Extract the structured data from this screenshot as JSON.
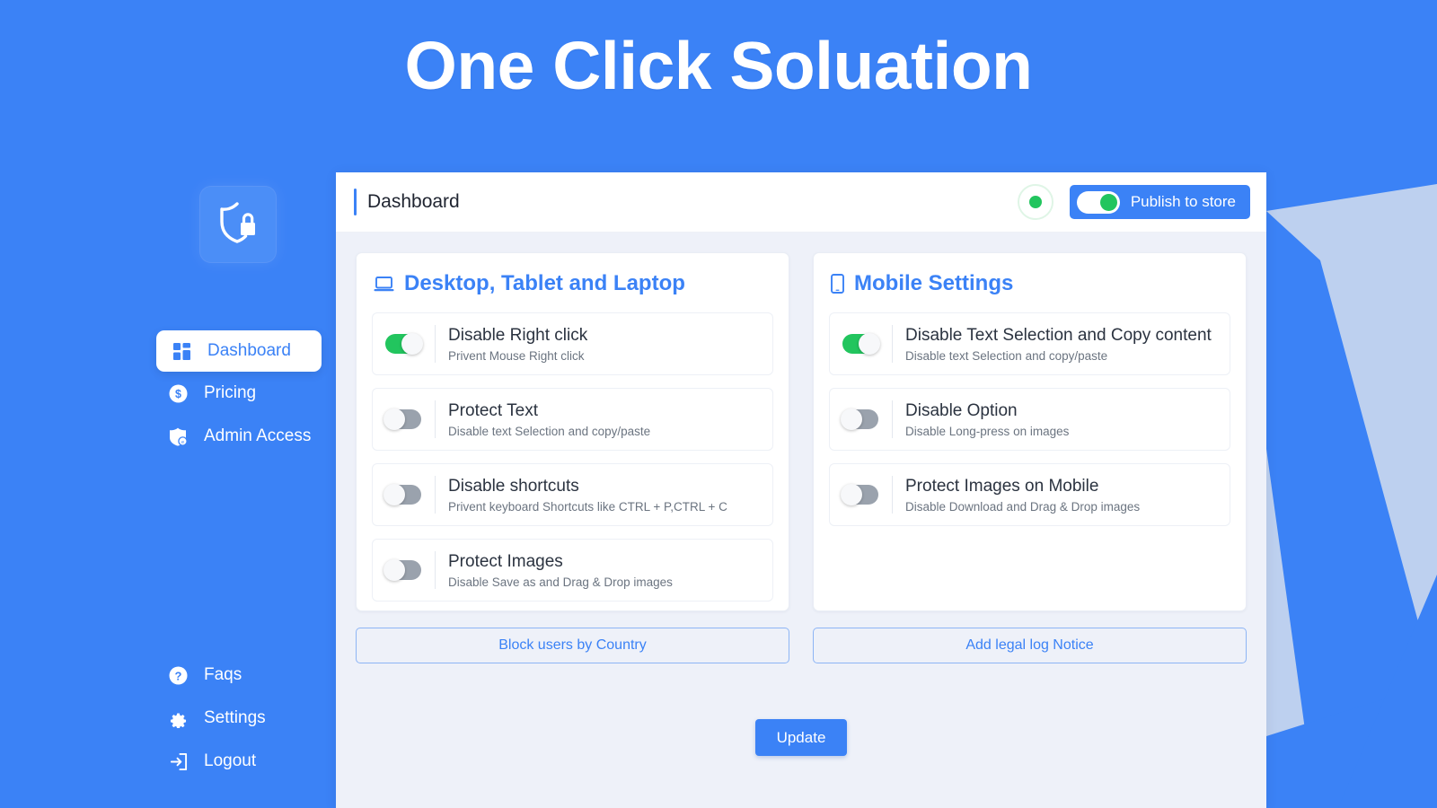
{
  "app": {
    "title": "One Click Soluation",
    "brand_logo_icon": "shield-lock-icon",
    "accent_color": "#3b82f6",
    "success_color": "#22c55e",
    "page_bg_color": "#eef1f9"
  },
  "sidebar": {
    "main_items": [
      {
        "label": "Dashboard",
        "icon": "grid-dashboard-icon",
        "active": true
      },
      {
        "label": "Pricing",
        "icon": "dollar-circle-icon",
        "active": false
      },
      {
        "label": "Admin Access",
        "icon": "shield-user-icon",
        "active": false
      }
    ],
    "bottom_items": [
      {
        "label": "Faqs",
        "icon": "question-circle-icon",
        "active": false
      },
      {
        "label": "Settings",
        "icon": "gear-icon",
        "active": false
      },
      {
        "label": "Logout",
        "icon": "logout-arrow-icon",
        "active": false
      }
    ]
  },
  "header": {
    "page_title": "Dashboard",
    "status_dot_color": "#22c55e",
    "publish_label": "Publish to store",
    "publish_enabled": true
  },
  "panels": [
    {
      "title": "Desktop, Tablet and Laptop",
      "icon": "laptop-icon",
      "settings": [
        {
          "label": "Disable Right click",
          "desc": "Privent Mouse Right click",
          "enabled": true
        },
        {
          "label": "Protect Text",
          "desc": "Disable text Selection and copy/paste",
          "enabled": false
        },
        {
          "label": "Disable shortcuts",
          "desc": "Privent keyboard Shortcuts like CTRL + P,CTRL + C",
          "enabled": false
        },
        {
          "label": "Protect Images",
          "desc": "Disable Save as and Drag & Drop images",
          "enabled": false
        }
      ],
      "action_label": "Block users by Country"
    },
    {
      "title": "Mobile Settings",
      "icon": "mobile-phone-icon",
      "settings": [
        {
          "label": "Disable Text Selection and Copy content",
          "desc": "Disable text Selection and copy/paste",
          "enabled": true
        },
        {
          "label": "Disable Option",
          "desc": "Disable Long-press on images",
          "enabled": false
        },
        {
          "label": "Protect Images on Mobile",
          "desc": "Disable Download and Drag & Drop images",
          "enabled": false
        }
      ],
      "action_label": "Add legal log Notice"
    }
  ],
  "footer": {
    "update_label": "Update"
  }
}
